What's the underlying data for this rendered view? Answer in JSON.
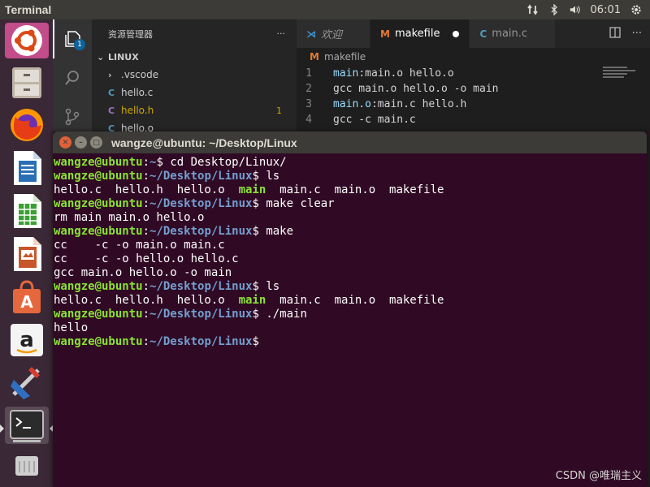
{
  "top_panel": {
    "app_title": "Terminal",
    "clock": "06:01"
  },
  "launcher": {
    "items": [
      {
        "name": "ubuntu-dash",
        "color": "#dd4814"
      },
      {
        "name": "files",
        "color": "#9a8b74"
      },
      {
        "name": "firefox",
        "color": "#e66000"
      },
      {
        "name": "libreoffice-writer",
        "color": "#2a6fb5"
      },
      {
        "name": "libreoffice-calc",
        "color": "#3aa033"
      },
      {
        "name": "libreoffice-impress",
        "color": "#c8562b"
      },
      {
        "name": "software-center",
        "color": "#e4673d"
      },
      {
        "name": "amazon",
        "color": "#f0f0f0"
      },
      {
        "name": "system-settings",
        "color": "#888888"
      },
      {
        "name": "terminal",
        "color": "#2b2b2b"
      }
    ]
  },
  "vscode": {
    "activity_badge": "1",
    "sidebar": {
      "title": "资源管理器",
      "more": "···",
      "folder": "LINUX",
      "files": [
        {
          "icon": "›",
          "name": ".vscode",
          "color": "#cccccc",
          "badge": ""
        },
        {
          "icon": "C",
          "name": "hello.c",
          "color": "#cccccc",
          "icon_color": "#519aba",
          "badge": ""
        },
        {
          "icon": "C",
          "name": "hello.h",
          "color": "#cca700",
          "icon_color": "#a074c4",
          "badge": "1"
        },
        {
          "icon": "C",
          "name": "hello.o",
          "color": "#cccccc",
          "icon_color": "#519aba",
          "badge": ""
        }
      ]
    },
    "tabs": [
      {
        "icon": "⋊",
        "label": "欢迎",
        "icon_color": "#3c99d4",
        "active": false,
        "dirty": false
      },
      {
        "icon": "M",
        "label": "makefile",
        "icon_color": "#e37933",
        "active": true,
        "dirty": true
      },
      {
        "icon": "C",
        "label": "main.c",
        "icon_color": "#519aba",
        "active": false,
        "dirty": false
      }
    ],
    "breadcrumb": {
      "icon": "M",
      "label": "makefile"
    },
    "code": [
      {
        "num": "1",
        "target": "main",
        "rest": ":main.o hello.o"
      },
      {
        "num": "2",
        "target": "",
        "rest": "    gcc main.o hello.o -o main"
      },
      {
        "num": "3",
        "target": "main.o",
        "rest": ":main.c hello.h"
      },
      {
        "num": "4",
        "target": "",
        "rest": "    gcc -c main.c"
      }
    ]
  },
  "terminal": {
    "title": "wangze@ubuntu: ~/Desktop/Linux",
    "lines": [
      {
        "user": "wangze@ubuntu",
        "path": "~",
        "cmd": " cd Desktop/Linux/"
      },
      {
        "user": "wangze@ubuntu",
        "path": "~/Desktop/Linux",
        "cmd": " ls"
      },
      {
        "ls": true,
        "a": "hello.c  hello.h  hello.o  ",
        "exe": "main",
        "b": "  main.c  main.o  makefile"
      },
      {
        "user": "wangze@ubuntu",
        "path": "~/Desktop/Linux",
        "cmd": " make clear"
      },
      {
        "out": "rm main main.o hello.o"
      },
      {
        "user": "wangze@ubuntu",
        "path": "~/Desktop/Linux",
        "cmd": " make"
      },
      {
        "out": "cc    -c -o main.o main.c"
      },
      {
        "out": "cc    -c -o hello.o hello.c"
      },
      {
        "out": "gcc main.o hello.o -o main"
      },
      {
        "user": "wangze@ubuntu",
        "path": "~/Desktop/Linux",
        "cmd": " ls"
      },
      {
        "ls": true,
        "a": "hello.c  hello.h  hello.o  ",
        "exe": "main",
        "b": "  main.c  main.o  makefile"
      },
      {
        "user": "wangze@ubuntu",
        "path": "~/Desktop/Linux",
        "cmd": " ./main"
      },
      {
        "out": "hello"
      },
      {
        "user": "wangze@ubuntu",
        "path": "~/Desktop/Linux",
        "cmd": " "
      }
    ]
  },
  "watermark": "CSDN @唯瑞主义"
}
